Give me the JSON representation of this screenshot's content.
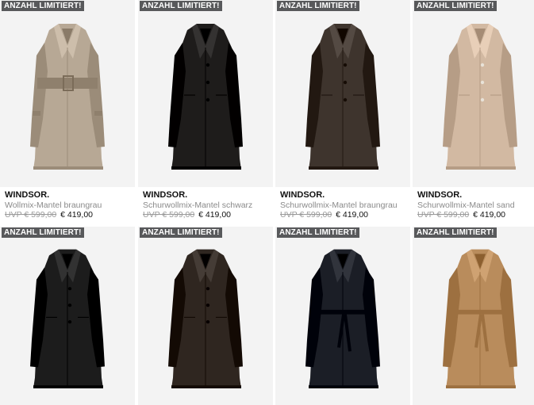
{
  "badge_text": "ANZAHL LIMITIERT!",
  "products": [
    {
      "brand": "WINDSOR.",
      "name": "Wollmix-Mantel braungrau",
      "old_price": "UVP € 599,00",
      "price": "€ 419,00",
      "coat_color": "#b7a895",
      "icon": "belted-wool-coat"
    },
    {
      "brand": "WINDSOR.",
      "name": "Schurwollmix-Mantel schwarz",
      "old_price": "UVP € 599,00",
      "price": "€ 419,00",
      "coat_color": "#1e1c1b",
      "icon": "wool-coat"
    },
    {
      "brand": "WINDSOR.",
      "name": "Schurwollmix-Mantel braungrau",
      "old_price": "UVP € 599,00",
      "price": "€ 419,00",
      "coat_color": "#3e342d",
      "icon": "wool-coat"
    },
    {
      "brand": "WINDSOR.",
      "name": "Schurwollmix-Mantel sand",
      "old_price": "UVP € 599,00",
      "price": "€ 419,00",
      "coat_color": "#d2b9a2",
      "icon": "wool-coat"
    },
    {
      "coat_color": "#1c1c1c",
      "icon": "wool-coat"
    },
    {
      "coat_color": "#2f2620",
      "icon": "wool-coat"
    },
    {
      "coat_color": "#1b1e26",
      "icon": "trench-coat"
    },
    {
      "coat_color": "#b98c5c",
      "icon": "trench-coat"
    }
  ]
}
